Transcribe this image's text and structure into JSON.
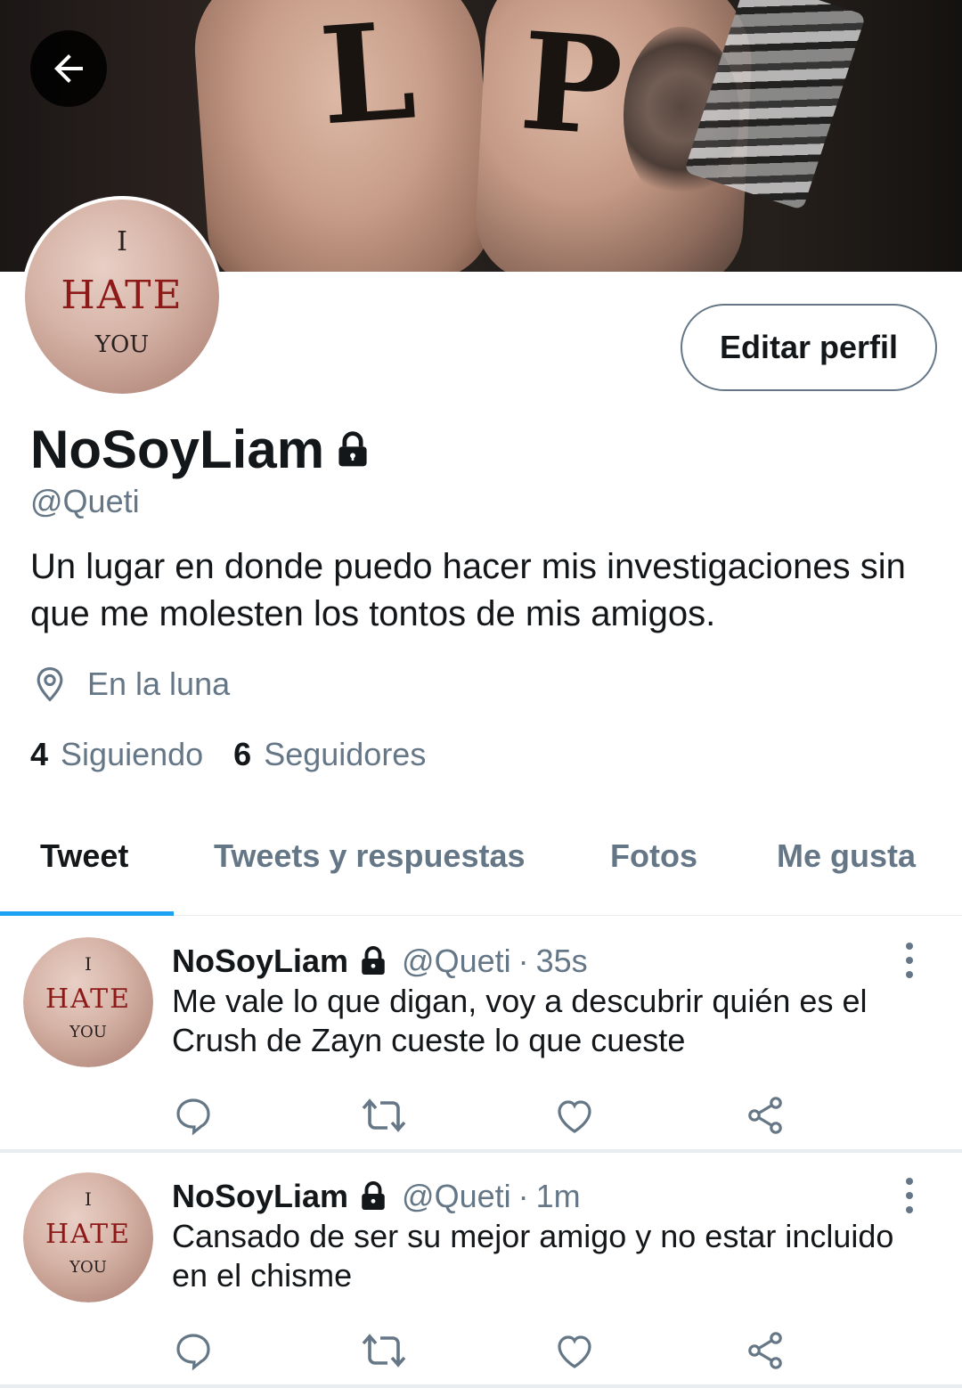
{
  "banner": {
    "letters": [
      "L",
      "P"
    ]
  },
  "avatar": {
    "lines": [
      "I",
      "HATE",
      "YOU"
    ]
  },
  "header": {
    "back_icon": "arrow-left-icon",
    "edit_label": "Editar perfil"
  },
  "profile": {
    "name": "NoSoyLiam",
    "handle": "@Queti",
    "bio": "Un lugar en donde puedo hacer mis investigaciones sin que me molesten los tontos de mis amigos.",
    "location": "En la luna",
    "following_count": "4",
    "following_label": "Siguiendo",
    "followers_count": "6",
    "followers_label": "Seguidores"
  },
  "tabs": [
    {
      "label": "Tweet",
      "active": true
    },
    {
      "label": "Tweets y respuestas",
      "active": false
    },
    {
      "label": "Fotos",
      "active": false
    },
    {
      "label": "Me gusta",
      "active": false
    }
  ],
  "tweets": [
    {
      "name": "NoSoyLiam",
      "handle": "@Queti",
      "dot": "·",
      "time": "35s",
      "text": "Me vale lo que digan, voy a descubrir quién es el Crush de Zayn cueste lo que cueste"
    },
    {
      "name": "NoSoyLiam",
      "handle": "@Queti",
      "dot": "·",
      "time": "1m",
      "text": "Cansado de ser su mejor amigo y no estar incluido en el chisme"
    }
  ],
  "colors": {
    "accent": "#1da1f2",
    "muted": "#657786",
    "text": "#14171a"
  }
}
